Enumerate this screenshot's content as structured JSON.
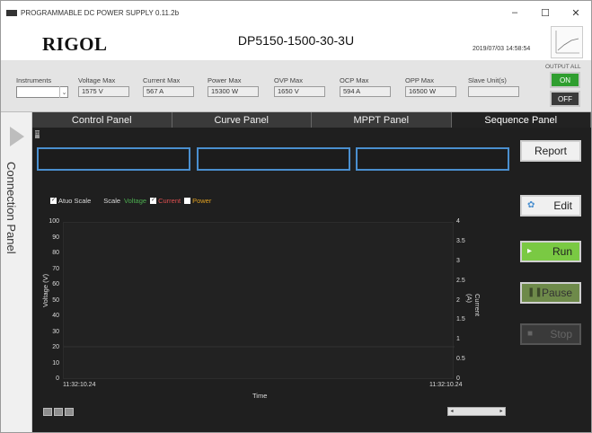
{
  "window": {
    "title": "PROGRAMMABLE DC POWER SUPPLY 0.11.2b",
    "minimize": "–",
    "maximize": "☐",
    "close": "✕"
  },
  "header": {
    "logo": "RIGOL",
    "model": "DP5150-1500-30-3U",
    "datetime": "2019/07/03  14:58:54"
  },
  "info": {
    "instruments_label": "Instruments",
    "instruments_value": "",
    "fields": [
      {
        "label": "Voltage Max",
        "value": "1575 V"
      },
      {
        "label": "Current Max",
        "value": "567 A"
      },
      {
        "label": "Power Max",
        "value": "15300 W"
      },
      {
        "label": "OVP Max",
        "value": "1650 V"
      },
      {
        "label": "OCP Max",
        "value": "594 A"
      },
      {
        "label": "OPP Max",
        "value": "16500 W"
      },
      {
        "label": "Slave Unit(s)",
        "value": ""
      }
    ],
    "output_all_label": "OUTPUT ALL",
    "on_label": "ON",
    "off_label": "OFF"
  },
  "side": {
    "connection_panel": "Connection Panel"
  },
  "tabs": [
    {
      "label": "Control Panel"
    },
    {
      "label": "Curve Panel"
    },
    {
      "label": "MPPT Panel"
    },
    {
      "label": "Sequence Panel"
    }
  ],
  "small_tag": "田",
  "legend": {
    "auto_scale": "Atuo Scale",
    "scale": "Scale",
    "voltage": "Voltage",
    "current": "Current",
    "power": "Power"
  },
  "colors": {
    "voltage": "#4caf50",
    "current": "#e05050",
    "power": "#e0a020",
    "accent": "#4a8fcf"
  },
  "chart_data": {
    "type": "line",
    "xlabel": "Time",
    "ylabel": "Voltage (V)",
    "y2label": "Current (A)",
    "ylim": [
      0,
      100
    ],
    "y2lim": [
      0,
      4
    ],
    "y_ticks": [
      "100",
      "90",
      "80",
      "70",
      "60",
      "50",
      "40",
      "30",
      "20",
      "10",
      "0"
    ],
    "y2_ticks": [
      "4",
      "3.5",
      "3",
      "2.5",
      "2",
      "1.5",
      "1",
      "0.5",
      "0"
    ],
    "x_ticks": [
      "11:32:10.24",
      "11:32:10.24"
    ],
    "series": [
      {
        "name": "Voltage",
        "values": []
      },
      {
        "name": "Current",
        "values": []
      },
      {
        "name": "Power",
        "values": []
      }
    ]
  },
  "buttons": {
    "report": "Report",
    "edit": "Edit",
    "run": "Run",
    "pause": "Pause",
    "stop": "Stop"
  }
}
